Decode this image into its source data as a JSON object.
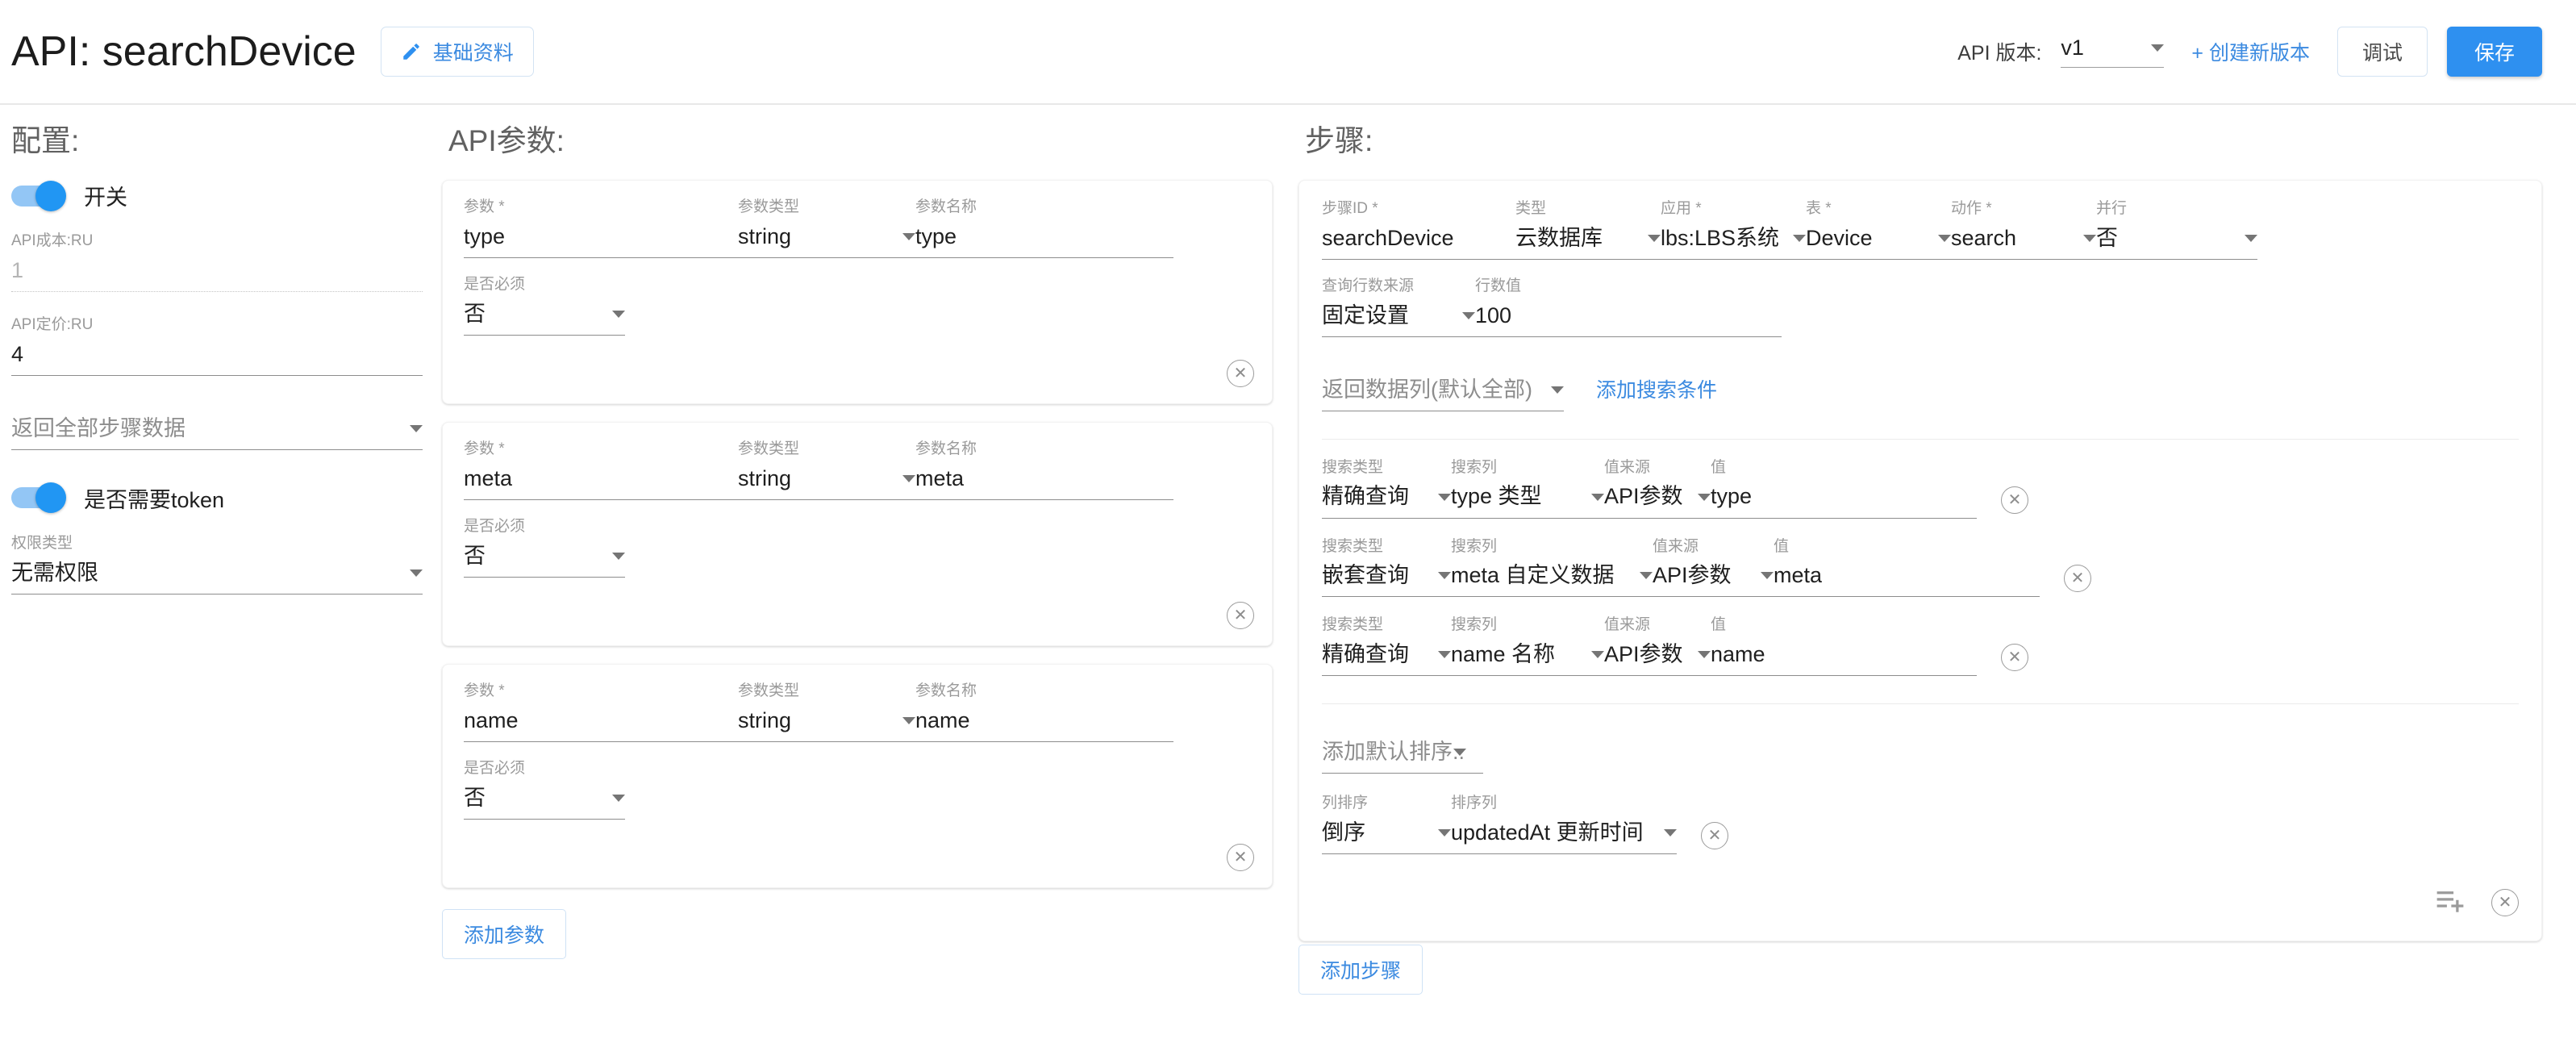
{
  "header": {
    "title": "API: searchDevice",
    "basic_info_label": "基础资料",
    "pencil_icon": "pencil-icon",
    "version_label": "API 版本:",
    "version_value": "v1",
    "new_version_link": "+ 创建新版本",
    "debug_label": "调试",
    "save_label": "保存",
    "accent_color": "#2e90f0",
    "link_color": "#3b8ae0"
  },
  "config": {
    "title": "配置:",
    "enable_switch_label": "开关",
    "enable_switch_on": true,
    "cost_label": "API成本:RU",
    "cost_value": "1",
    "price_label": "API定价:RU",
    "price_value": "4",
    "return_all_steps": "返回全部步骤数据",
    "token_switch_label": "是否需要token",
    "token_switch_on": true,
    "auth_type_label": "权限类型",
    "auth_type_value": "无需权限"
  },
  "params": {
    "title": "API参数:",
    "labels": {
      "param": "参数",
      "param_type": "参数类型",
      "param_name": "参数名称",
      "required": "是否必须",
      "required_mark": "*"
    },
    "items": [
      {
        "param": "type",
        "type": "string",
        "name": "type",
        "required": "否"
      },
      {
        "param": "meta",
        "type": "string",
        "name": "meta",
        "required": "否"
      },
      {
        "param": "name",
        "type": "string",
        "name": "name",
        "required": "否"
      }
    ],
    "add_param_label": "添加参数"
  },
  "steps": {
    "title": "步骤:",
    "labels": {
      "step_id": "步骤ID",
      "type": "类型",
      "app": "应用",
      "table": "表",
      "action": "动作",
      "parallel": "并行",
      "row_count_source": "查询行数来源",
      "row_count_value": "行数值",
      "search_type": "搜索类型",
      "search_column": "搜索列",
      "value_source": "值来源",
      "value": "值",
      "column_sort": "列排序",
      "sort_column": "排序列",
      "req": "*"
    },
    "step": {
      "step_id": "searchDevice",
      "type": "云数据库",
      "app": "lbs:LBS系统",
      "table": "Device",
      "action": "search",
      "parallel": "否",
      "row_count_source": "固定设置",
      "row_count_value": "100",
      "return_columns_placeholder": "返回数据列(默认全部)",
      "add_condition_link": "添加搜索条件",
      "conditions": [
        {
          "search_type": "精确查询",
          "search_column": "type 类型",
          "value_source": "API参数",
          "value": "type"
        },
        {
          "search_type": "嵌套查询",
          "search_column": "meta 自定义数据",
          "value_source": "API参数",
          "value": "meta"
        },
        {
          "search_type": "精确查询",
          "search_column": "name 名称",
          "value_source": "API参数",
          "value": "name"
        }
      ],
      "add_default_sort": "添加默认排序..",
      "sorts": [
        {
          "direction": "倒序",
          "column": "updatedAt 更新时间"
        }
      ],
      "footer_icons": [
        "playlist-add-icon",
        "delete-circle-icon"
      ]
    },
    "add_step_label": "添加步骤"
  },
  "icons": {
    "delete": "✕",
    "close_circle": "delete-circle-icon"
  }
}
